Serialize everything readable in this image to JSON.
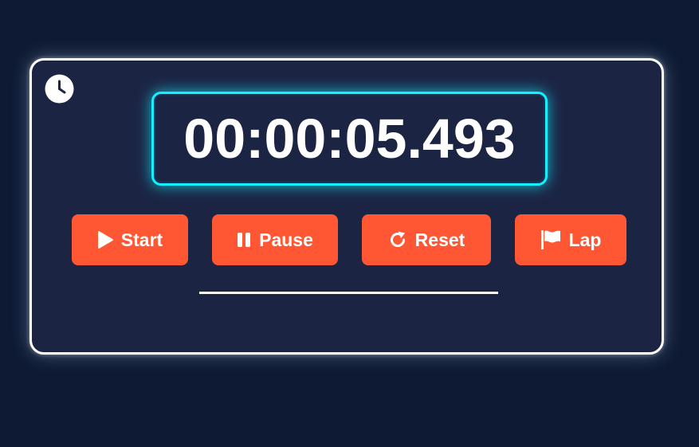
{
  "stopwatch": {
    "time_display": "00:00:05.493"
  },
  "controls": {
    "start_label": "Start",
    "pause_label": "Pause",
    "reset_label": "Reset",
    "lap_label": "Lap"
  },
  "icons": {
    "header": "clock-icon",
    "start": "play-icon",
    "pause": "pause-icon",
    "reset": "reset-icon",
    "lap": "flag-icon"
  },
  "colors": {
    "background": "#0e1a33",
    "panel": "#1c2444",
    "panel_border": "#ffffff",
    "display_border": "#14f0ff",
    "button": "#ff5733",
    "text": "#ffffff"
  },
  "laps": []
}
